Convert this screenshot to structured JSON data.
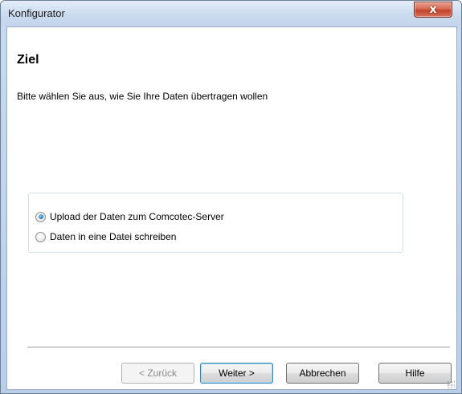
{
  "window": {
    "title": "Konfigurator",
    "close_label": "x"
  },
  "page": {
    "heading": "Ziel",
    "instruction": "Bitte wählen Sie aus, wie Sie Ihre Daten übertragen wollen"
  },
  "options": {
    "items": [
      {
        "label": "Upload der Daten zum Comcotec-Server",
        "checked": true
      },
      {
        "label": "Daten in eine Datei schreiben",
        "checked": false
      }
    ]
  },
  "buttons": {
    "back": "< Zurück",
    "next": "Weiter >",
    "cancel": "Abbrechen",
    "help": "Hilfe"
  }
}
